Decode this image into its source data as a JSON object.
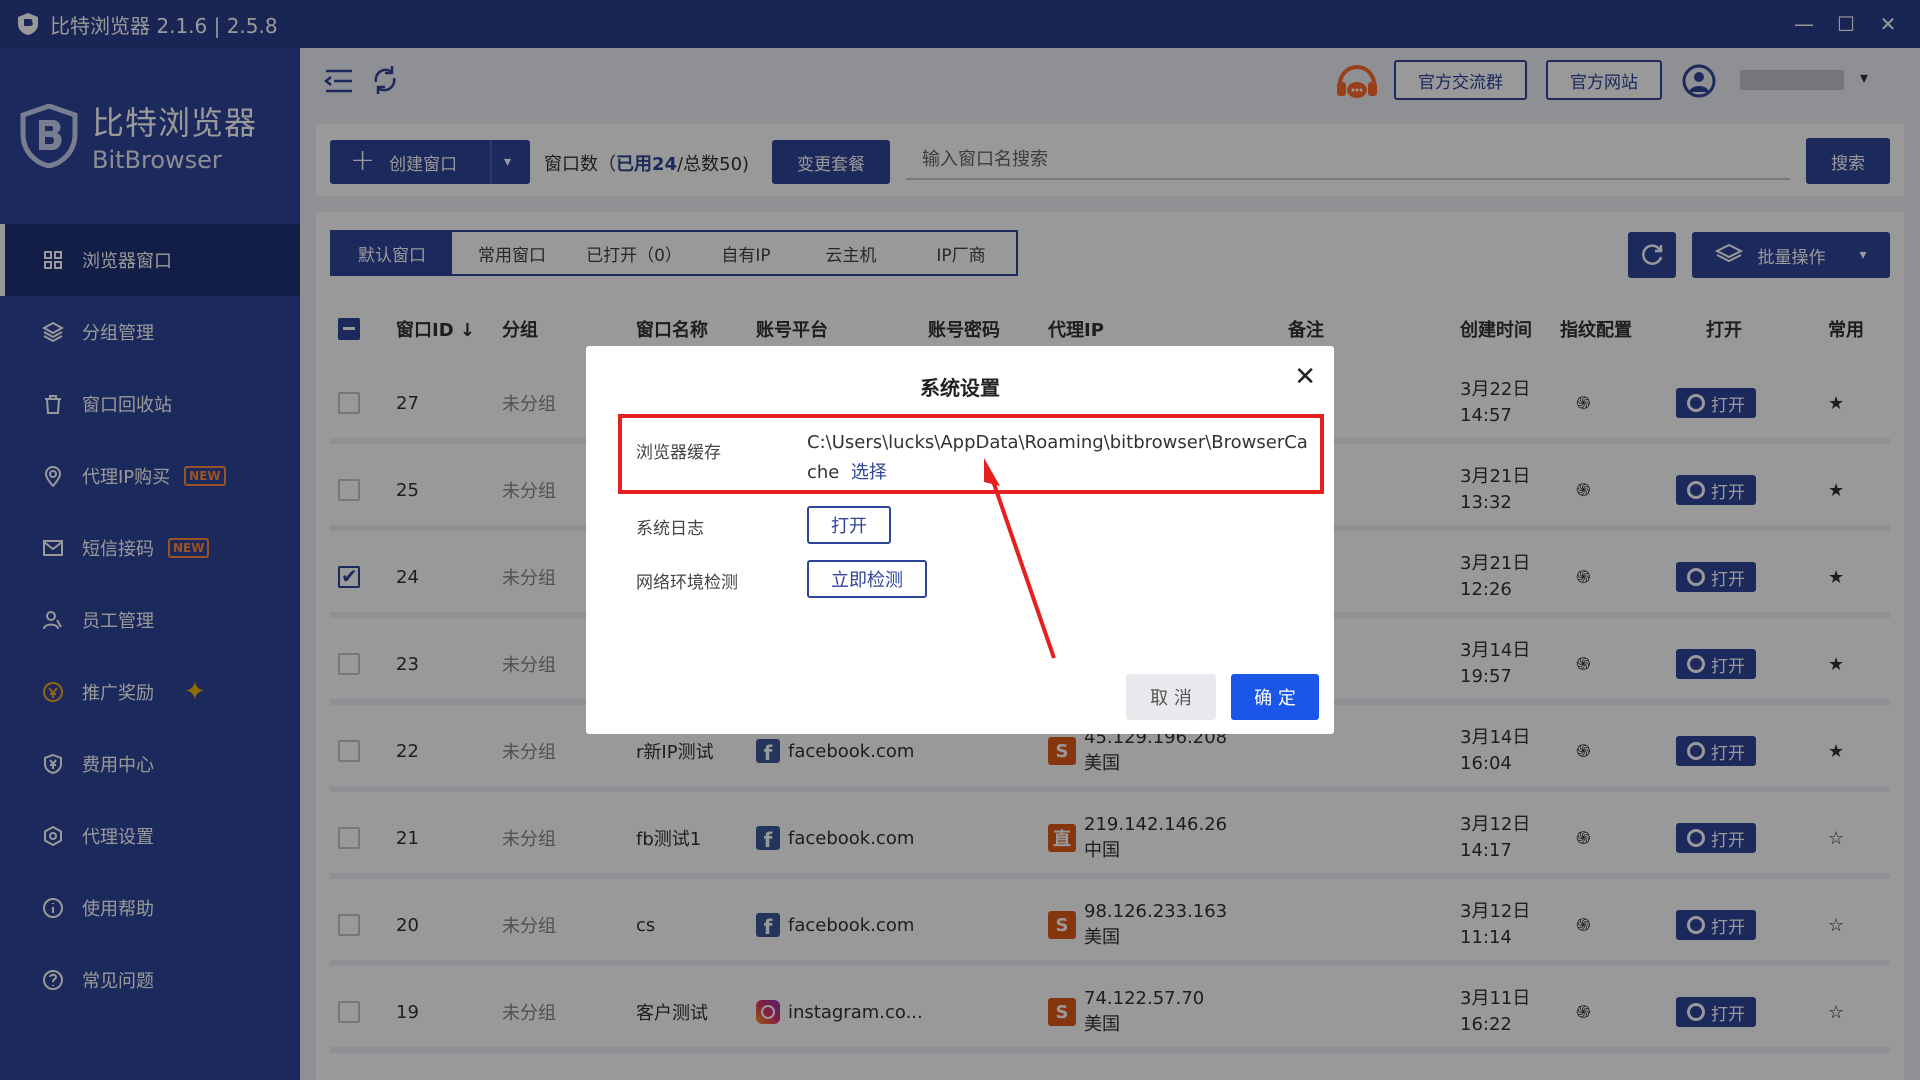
{
  "app": {
    "title": "比特浏览器 2.1.6 | 2.5.8",
    "brand_cn": "比特浏览器",
    "brand_en": "BitBrowser"
  },
  "window_controls": [
    "minimize-icon",
    "maximize-icon",
    "close-icon"
  ],
  "colors": {
    "sidebar": "#2d4599",
    "accent": "#2d4599",
    "ok_button": "#1a56e8",
    "highlight_border": "#e62020",
    "star": "#f0a500"
  },
  "sidebar": {
    "items": [
      {
        "label": "浏览器窗口",
        "icon": "grid-icon",
        "active": true
      },
      {
        "label": "分组管理",
        "icon": "layers-icon"
      },
      {
        "label": "窗口回收站",
        "icon": "recycle-bin-icon"
      },
      {
        "label": "代理IP购买",
        "icon": "location-pin-icon",
        "badge": "NEW"
      },
      {
        "label": "短信接码",
        "icon": "mail-icon",
        "badge": "NEW"
      },
      {
        "label": "员工管理",
        "icon": "users-icon"
      },
      {
        "label": "推广奖励",
        "icon": "reward-icon"
      },
      {
        "label": "费用中心",
        "icon": "shield-yen-icon"
      },
      {
        "label": "代理设置",
        "icon": "settings-ring-icon"
      },
      {
        "label": "使用帮助",
        "icon": "info-icon"
      },
      {
        "label": "常见问题",
        "icon": "question-icon"
      }
    ]
  },
  "header": {
    "group_button": "官方交流群",
    "site_button": "官方网站"
  },
  "toolbar": {
    "create_label": "创建窗口",
    "count_prefix": "窗口数（",
    "count_used": "已用24",
    "count_suffix": "/总数50)",
    "change_plan": "变更套餐",
    "search_placeholder": "输入窗口名搜索",
    "search_button": "搜索",
    "batch_label": "批量操作"
  },
  "tabs": [
    "默认窗口",
    "常用窗口",
    "已打开（0）",
    "自有IP",
    "云主机",
    "IP厂商"
  ],
  "table": {
    "headers": [
      "窗口ID ↓",
      "分组",
      "窗口名称",
      "账号平台",
      "账号密码",
      "代理IP",
      "备注",
      "创建时间",
      "指纹配置",
      "打开",
      "常用"
    ],
    "open_label": "打开",
    "rows": [
      {
        "id": "27",
        "group": "未分组",
        "name": "",
        "platform": "",
        "ip": "",
        "country": "",
        "provider": "",
        "date": "3月22日",
        "time": "14:57",
        "starred": true,
        "checked": false
      },
      {
        "id": "25",
        "group": "未分组",
        "name": "",
        "platform": "",
        "ip": "",
        "country": "",
        "provider": "",
        "date": "3月21日",
        "time": "13:32",
        "starred": true,
        "checked": false
      },
      {
        "id": "24",
        "group": "未分组",
        "name": "",
        "platform": "",
        "ip": "",
        "country": "",
        "provider": "",
        "date": "3月21日",
        "time": "12:26",
        "starred": true,
        "checked": true
      },
      {
        "id": "23",
        "group": "未分组",
        "name": "",
        "platform": "",
        "ip": "",
        "country": "",
        "provider": "",
        "date": "3月14日",
        "time": "19:57",
        "starred": true,
        "checked": false
      },
      {
        "id": "22",
        "group": "未分组",
        "name": "r新IP测试",
        "platform": "facebook.com",
        "platform_icon": "facebook-icon",
        "ip": "45.129.196.208",
        "country": "美国",
        "provider": "S",
        "date": "3月14日",
        "time": "16:04",
        "starred": true,
        "checked": false
      },
      {
        "id": "21",
        "group": "未分组",
        "name": "fb测试1",
        "platform": "facebook.com",
        "platform_icon": "facebook-icon",
        "ip": "219.142.146.26",
        "country": "中国",
        "provider": "直",
        "date": "3月12日",
        "time": "14:17",
        "starred": false,
        "checked": false
      },
      {
        "id": "20",
        "group": "未分组",
        "name": "cs",
        "platform": "facebook.com",
        "platform_icon": "facebook-icon",
        "ip": "98.126.233.163",
        "country": "美国",
        "provider": "S",
        "date": "3月12日",
        "time": "11:14",
        "starred": false,
        "checked": false
      },
      {
        "id": "19",
        "group": "未分组",
        "name": "客户测试",
        "platform": "instagram.co...",
        "platform_icon": "instagram-icon",
        "ip": "74.122.57.70",
        "country": "美国",
        "provider": "S",
        "date": "3月11日",
        "time": "16:22",
        "starred": false,
        "checked": false
      }
    ]
  },
  "modal": {
    "title": "系统设置",
    "cache_label": "浏览器缓存",
    "cache_path": "C:\\Users\\lucks\\AppData\\Roaming\\bitbrowser\\BrowserCache",
    "choose_link": "选择",
    "log_label": "系统日志",
    "log_button": "打开",
    "net_label": "网络环境检测",
    "net_button": "立即检测",
    "cancel": "取 消",
    "ok": "确 定"
  }
}
